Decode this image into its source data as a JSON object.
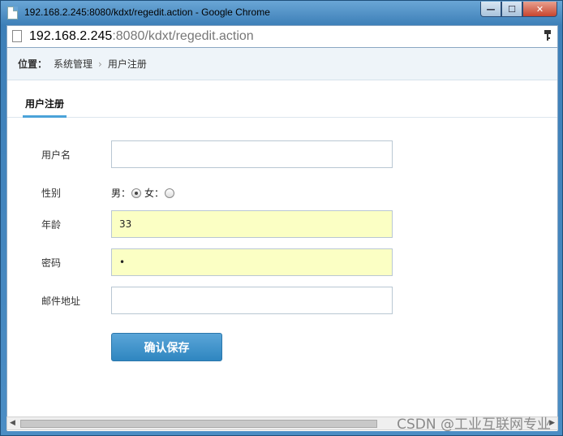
{
  "window": {
    "title": "192.168.2.245:8080/kdxt/regedit.action - Google Chrome",
    "min_glyph": "—",
    "max_glyph": "☐",
    "close_glyph": "✕"
  },
  "address": {
    "host": "192.168.2.245",
    "path": ":8080/kdxt/regedit.action"
  },
  "breadcrumb": {
    "label": "位置：",
    "items": [
      "系统管理",
      "用户注册"
    ],
    "separator": "›"
  },
  "tab": {
    "label": "用户注册"
  },
  "form": {
    "username": {
      "label": "用户名",
      "value": ""
    },
    "gender": {
      "label": "性别",
      "male": "男：",
      "female": "女：",
      "selected": "male"
    },
    "age": {
      "label": "年龄",
      "value": "33"
    },
    "password": {
      "label": "密码",
      "value": "•"
    },
    "email": {
      "label": "邮件地址",
      "value": ""
    },
    "save_label": "确认保存"
  },
  "scroll": {
    "left_arrow": "◀",
    "right_arrow": "▶"
  },
  "watermark": "CSDN @工业互联网专业",
  "colors": {
    "accent": "#4ba3d9",
    "button": "#3b93cc",
    "filled_field": "#fbffc4"
  }
}
